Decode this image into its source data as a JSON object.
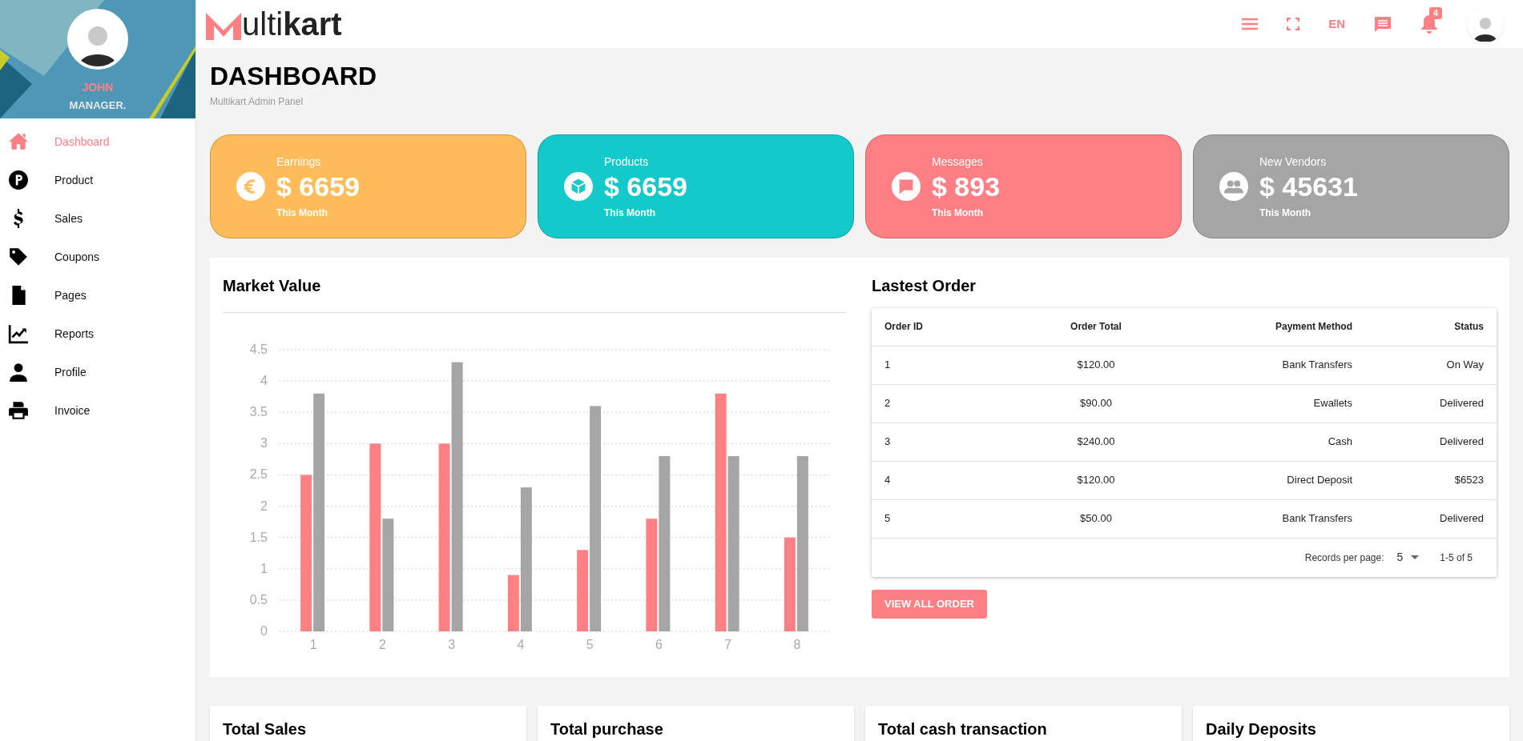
{
  "sidebar": {
    "user": {
      "name": "JOHN",
      "role": "MANAGER."
    },
    "items": [
      {
        "label": "Dashboard",
        "selected": true
      },
      {
        "label": "Product",
        "selected": false
      },
      {
        "label": "Sales",
        "selected": false
      },
      {
        "label": "Coupons",
        "selected": false
      },
      {
        "label": "Pages",
        "selected": false
      },
      {
        "label": "Reports",
        "selected": false
      },
      {
        "label": "Profile",
        "selected": false
      },
      {
        "label": "Invoice",
        "selected": false
      }
    ]
  },
  "header": {
    "logo": "ulti**kart**",
    "language": "EN",
    "notification_count": "4"
  },
  "page": {
    "title": "DASHBOARD",
    "subtitle": "Multikart Admin Panel"
  },
  "stat_cards": [
    {
      "label": "Earnings",
      "value": "$ 6659",
      "period": "This Month",
      "color": "#ffbc58"
    },
    {
      "label": "Products",
      "value": "$ 6659",
      "period": "This Month",
      "color": "#13c9ca"
    },
    {
      "label": "Messages",
      "value": "$ 893",
      "period": "This Month",
      "color": "#ff8084"
    },
    {
      "label": "New Vendors",
      "value": "$ 45631",
      "period": "This Month",
      "color": "#a5a5a5"
    }
  ],
  "market_value": {
    "title": "Market Value",
    "chart_data": {
      "type": "bar",
      "categories": [
        "1",
        "2",
        "3",
        "4",
        "5",
        "6",
        "7",
        "8"
      ],
      "series": [
        {
          "color": "#ff8084",
          "values": [
            2.5,
            3,
            3,
            0.9,
            1.3,
            1.8,
            3.8,
            1.5
          ]
        },
        {
          "color": "#a5a5a5",
          "values": [
            3.8,
            1.8,
            4.3,
            2.3,
            3.6,
            2.8,
            2.8,
            2.8
          ]
        }
      ],
      "grid": true,
      "ylim": [
        0,
        4.5
      ],
      "yticks": [
        0,
        0.5,
        1,
        1.5,
        2,
        2.5,
        3,
        3.5,
        4,
        4.5
      ]
    }
  },
  "latest_order": {
    "title": "Lastest Order",
    "columns": [
      "Order ID",
      "Order Total",
      "Payment Method",
      "Status"
    ],
    "rows": [
      [
        "1",
        "$120.00",
        "Bank Transfers",
        "On Way"
      ],
      [
        "2",
        "$90.00",
        "Ewallets",
        "Delivered"
      ],
      [
        "3",
        "$240.00",
        "Cash",
        "Delivered"
      ],
      [
        "4",
        "$120.00",
        "Direct Deposit",
        "$6523"
      ],
      [
        "5",
        "$50.00",
        "Bank Transfers",
        "Delivered"
      ]
    ],
    "records_label": "Records per page:",
    "records_value": "5",
    "range": "1-5 of 5",
    "button": "VIEW ALL ORDER"
  },
  "bottom_cards": [
    {
      "title": "Total Sales"
    },
    {
      "title": "Total purchase"
    },
    {
      "title": "Total cash transaction"
    },
    {
      "title": "Daily Deposits"
    }
  ]
}
